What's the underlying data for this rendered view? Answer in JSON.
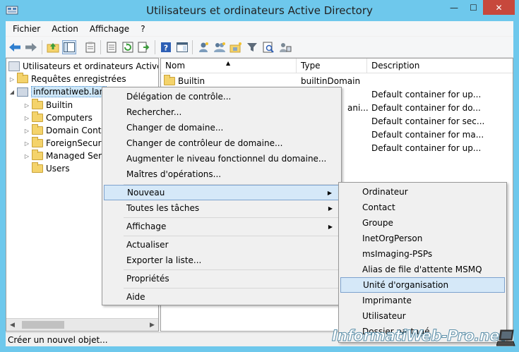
{
  "window": {
    "title": "Utilisateurs et ordinateurs Active Directory",
    "controls": {
      "minimize": "—",
      "maximize": "☐",
      "close": "✕"
    }
  },
  "menubar": [
    "Fichier",
    "Action",
    "Affichage",
    "?"
  ],
  "toolbar": {
    "icons": [
      "back-arrow-icon",
      "forward-arrow-icon",
      "up-folder-icon",
      "show-hide-tree-icon",
      "clipboard-icon",
      "export-list-icon",
      "refresh-icon",
      "export-icon",
      "help-icon",
      "console-icon",
      "add-user-icon",
      "add-group-icon",
      "add-ou-icon",
      "filter-icon",
      "find-icon",
      "delegate-icon"
    ]
  },
  "tree": {
    "root": "Utilisateurs et ordinateurs Active Dir",
    "saved_queries": "Requêtes enregistrées",
    "domain": "informatiweb.lan",
    "children": [
      "Builtin",
      "Computers",
      "Domain Cont",
      "ForeignSecuri",
      "Managed Serv",
      "Users"
    ]
  },
  "list": {
    "columns": [
      "Nom",
      "Type",
      "Description"
    ],
    "rows": [
      {
        "name": "Builtin",
        "type": "builtinDomain",
        "description": ""
      },
      {
        "name": "",
        "type": "",
        "description": "Default container for up..."
      },
      {
        "name": "",
        "type": "ani...",
        "description": "Default container for do..."
      },
      {
        "name": "",
        "type": "",
        "description": "Default container for sec..."
      },
      {
        "name": "",
        "type": "",
        "description": "Default container for ma..."
      },
      {
        "name": "",
        "type": "",
        "description": "Default container for up..."
      }
    ]
  },
  "context_menu": {
    "items": [
      "Délégation de contrôle...",
      "Rechercher...",
      "Changer de domaine...",
      "Changer de contrôleur de domaine...",
      "Augmenter le niveau fonctionnel du domaine...",
      "Maîtres d'opérations...",
      "Nouveau",
      "Toutes les tâches",
      "Affichage",
      "Actualiser",
      "Exporter la liste...",
      "Propriétés",
      "Aide"
    ],
    "highlighted": "Nouveau"
  },
  "submenu": {
    "items": [
      "Ordinateur",
      "Contact",
      "Groupe",
      "InetOrgPerson",
      "msImaging-PSPs",
      "Alias de file d'attente MSMQ",
      "Unité d'organisation",
      "Imprimante",
      "Utilisateur",
      "Dossier partagé"
    ],
    "highlighted": "Unité d'organisation"
  },
  "status": "Créer un nouvel objet...",
  "watermark": "InformatiWeb-Pro.net",
  "colors": {
    "title_bar": "#6ec8ec",
    "close_button": "#c7483c",
    "highlight": "#d5e8f8",
    "highlight_border": "#7da2ce"
  }
}
